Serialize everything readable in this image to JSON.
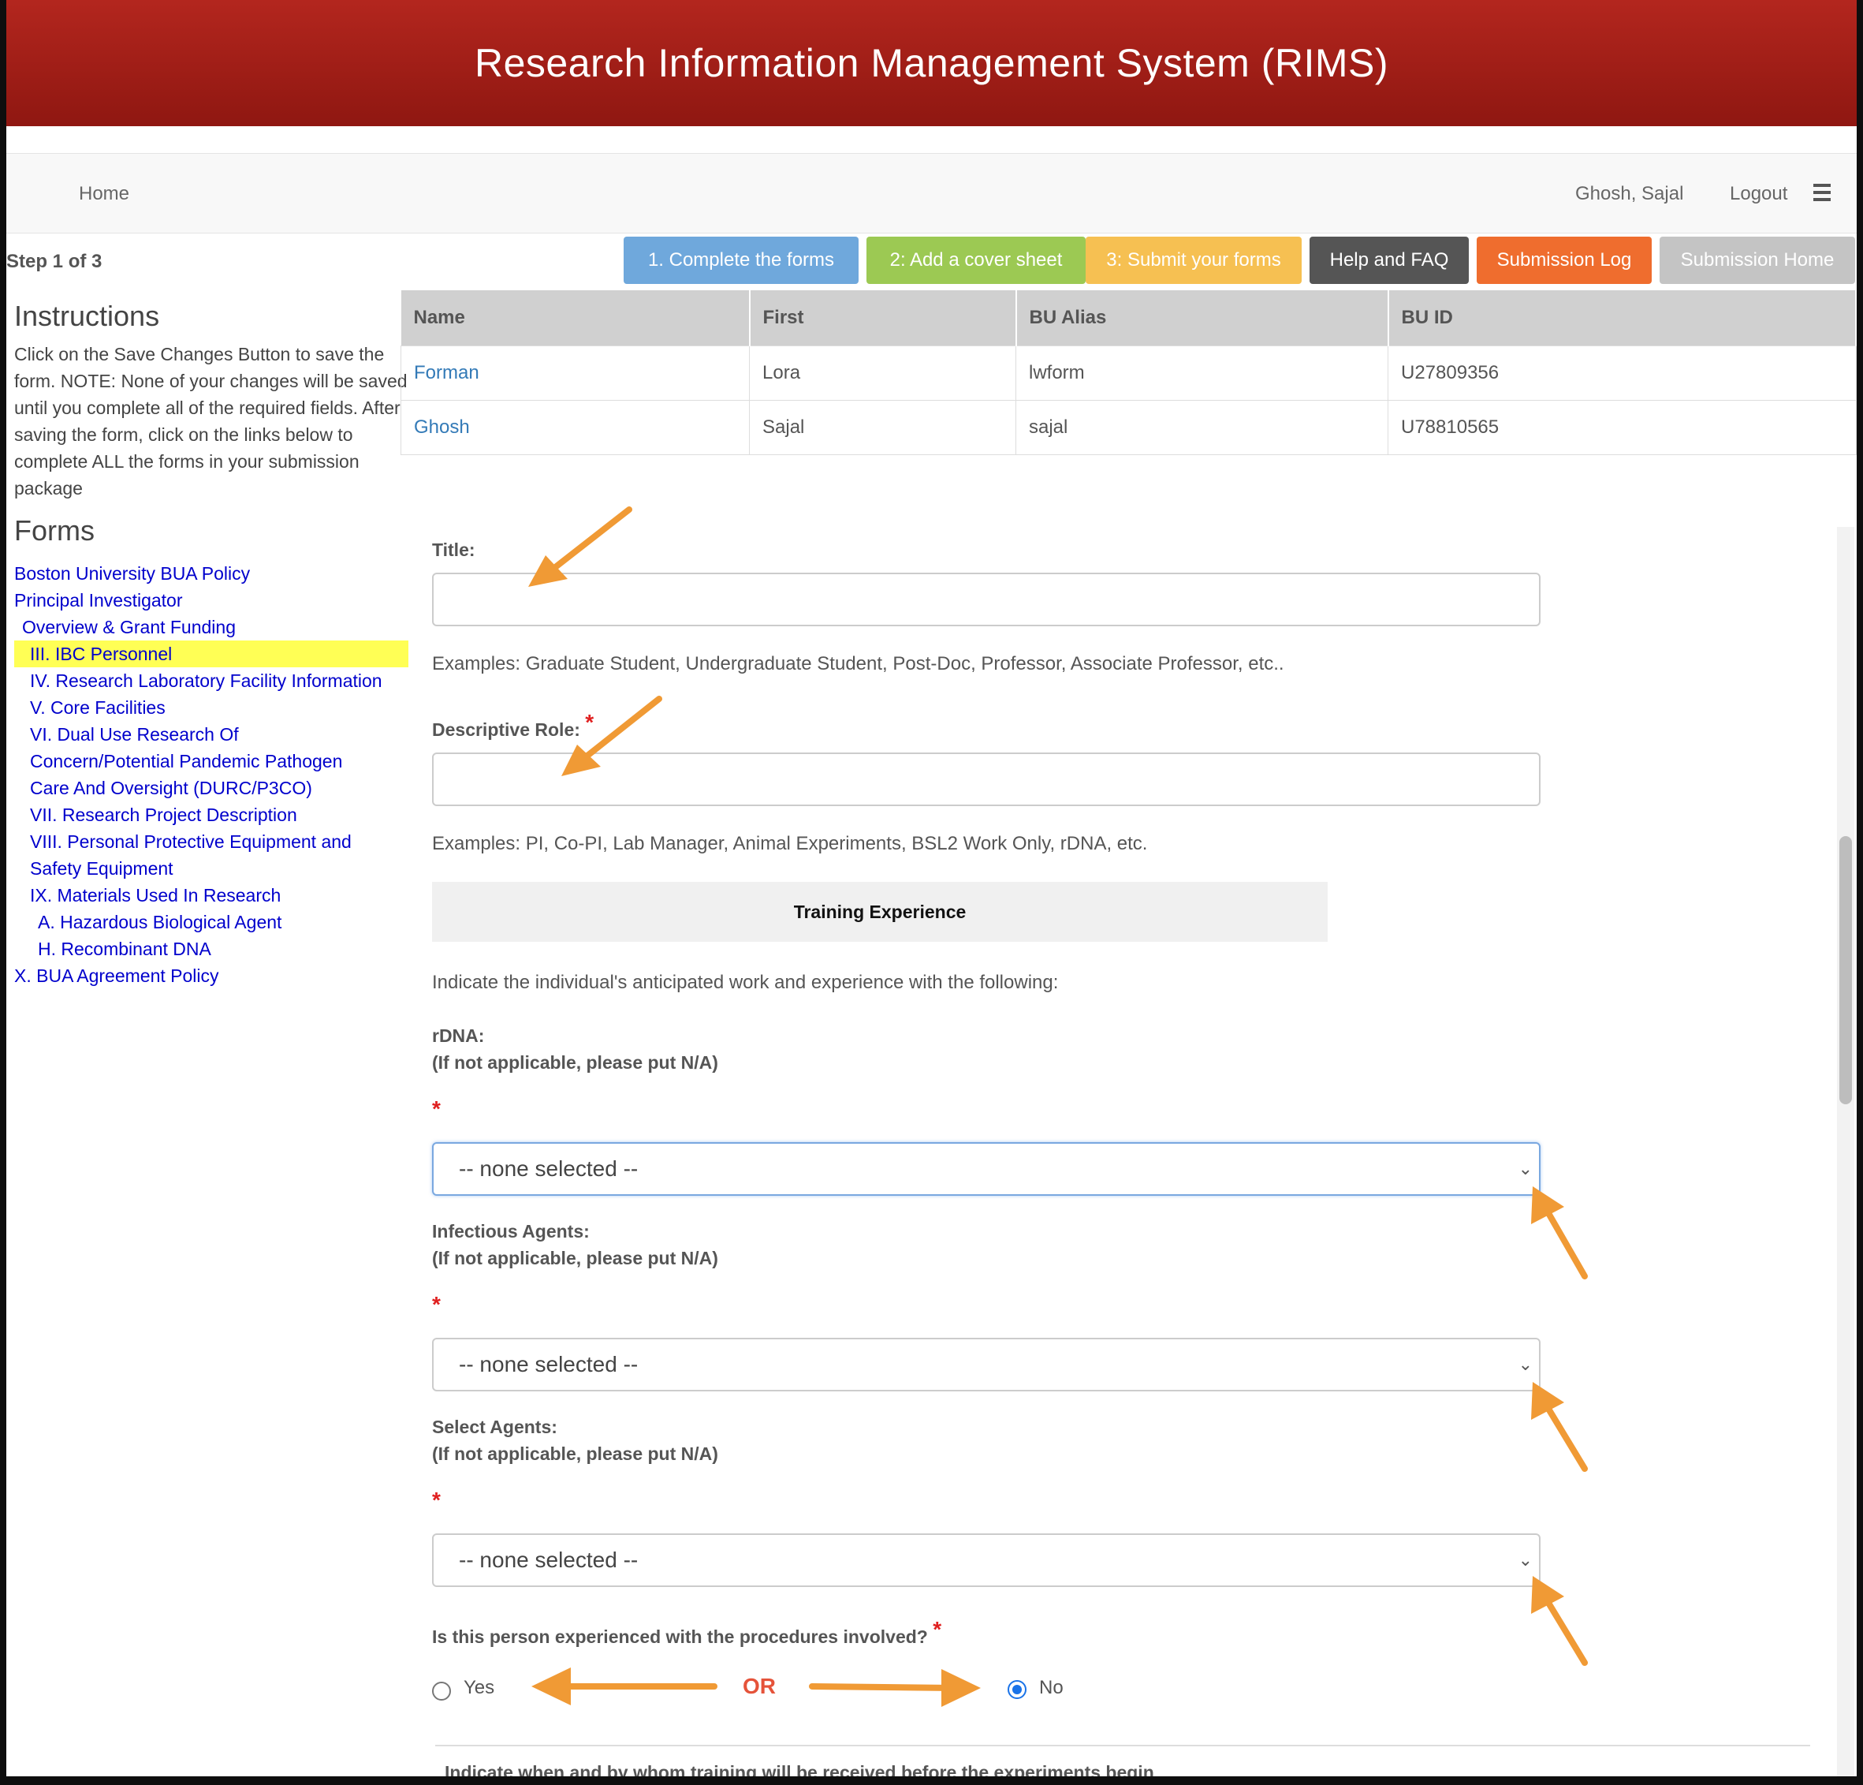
{
  "app": {
    "title": "Research Information Management System (RIMS)"
  },
  "nav": {
    "home": "Home",
    "user": "Ghosh, Sajal",
    "logout": "Logout",
    "menu_icon": "hamburger-menu-icon"
  },
  "step": "Step 1 of 3",
  "buttons": [
    {
      "label": "1. Complete the forms",
      "color": "#6fa8dc"
    },
    {
      "label": "2: Add a cover sheet",
      "color": "#9cc953"
    },
    {
      "label": "3: Submit your forms",
      "color": "#f6c052"
    },
    {
      "label": "Help and FAQ",
      "color": "#555555"
    },
    {
      "label": "Submission Log",
      "color": "#ef6d2e"
    },
    {
      "label": "Submission Home",
      "color": "#c4c4c4"
    }
  ],
  "sidebar": {
    "instructions_title": "Instructions",
    "instructions_text": "Click on the Save Changes Button to save the form. NOTE: None of your changes will be saved until you complete all of the required fields. After saving the form, click on the links below to complete ALL the forms in your submission package",
    "forms_title": "Forms",
    "forms": [
      "Boston University BUA Policy",
      "Principal Investigator",
      "Overview & Grant Funding",
      "III. IBC Personnel",
      "IV. Research Laboratory Facility Information",
      "V. Core Facilities",
      "VI. Dual Use Research Of Concern/Potential Pandemic Pathogen Care And Oversight (DURC/P3CO)",
      "VII. Research Project Description",
      "VIII. Personal Protective Equipment and Safety Equipment",
      "IX. Materials Used In Research",
      "A. Hazardous Biological Agent",
      "H. Recombinant DNA",
      "X. BUA Agreement Policy"
    ]
  },
  "personnel_table": {
    "headers": [
      "Name",
      "First",
      "BU Alias",
      "BU ID"
    ],
    "rows": [
      [
        "Forman",
        "Lora",
        "lwform",
        "U27809356"
      ],
      [
        "Ghosh",
        "Sajal",
        "sajal",
        "U78810565"
      ]
    ]
  },
  "form": {
    "title_label": "Title:",
    "title_value": "",
    "title_help": "Examples: Graduate Student, Undergraduate Student, Post-Doc, Professor, Associate Professor, etc..",
    "role_label": "Descriptive Role:",
    "role_value": "",
    "role_help": "Examples: PI, Co-PI, Lab Manager, Animal Experiments, BSL2 Work Only, rDNA, etc.",
    "section_title": "Training Experience",
    "indicate_text": "Indicate the individual's anticipated work and experience with the following:",
    "required_mark": "*",
    "rdna_label": "rDNA:",
    "na_hint": "(If not applicable, please put N/A)",
    "infectious_label": "Infectious Agents:",
    "select_agents_label": "Select Agents:",
    "select_value": "-- none selected --",
    "experienced_question": "Is this person experienced with the procedures involved?",
    "yes_label": "Yes",
    "no_label": "No",
    "selected_answer": "No",
    "or_text": "OR",
    "training_text": "Indicate when and by whom training will be received before the experiments begin"
  },
  "annotation_color": "#f09a35"
}
